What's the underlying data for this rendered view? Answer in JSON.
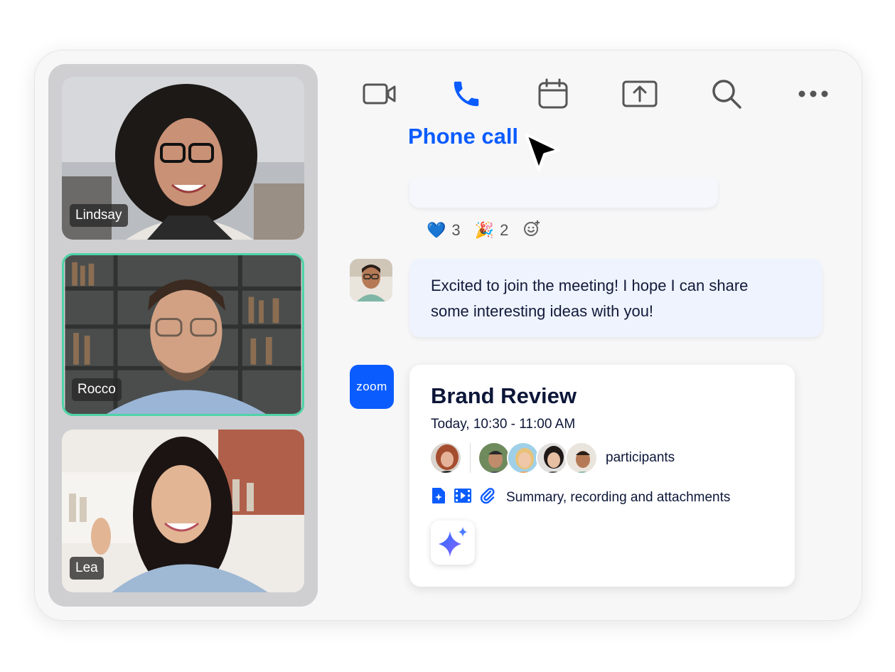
{
  "participants_video": [
    {
      "name": "Lindsay"
    },
    {
      "name": "Rocco"
    },
    {
      "name": "Lea"
    }
  ],
  "toolbar": {
    "icons": [
      "video-icon",
      "phone-icon",
      "calendar-icon",
      "share-screen-icon",
      "search-icon",
      "more-icon"
    ],
    "active": "phone-icon",
    "tooltip": "Phone call"
  },
  "reactions": [
    {
      "emoji": "💙",
      "count": "3"
    },
    {
      "emoji": "🎉",
      "count": "2"
    }
  ],
  "message": {
    "text_line1": "Excited to join the meeting! I hope I can share",
    "text_line2": "some interesting ideas with you!"
  },
  "meeting_card": {
    "logo": "zoom",
    "title": "Brand Review",
    "time": "Today, 10:30 - 11:00 AM",
    "participants_label": "participants",
    "attachments_label": "Summary, recording and attachments"
  },
  "colors": {
    "accent": "#0b5cff",
    "active_speaker_border": "#4fd3a6",
    "bubble_bg": "#eef3fd"
  }
}
